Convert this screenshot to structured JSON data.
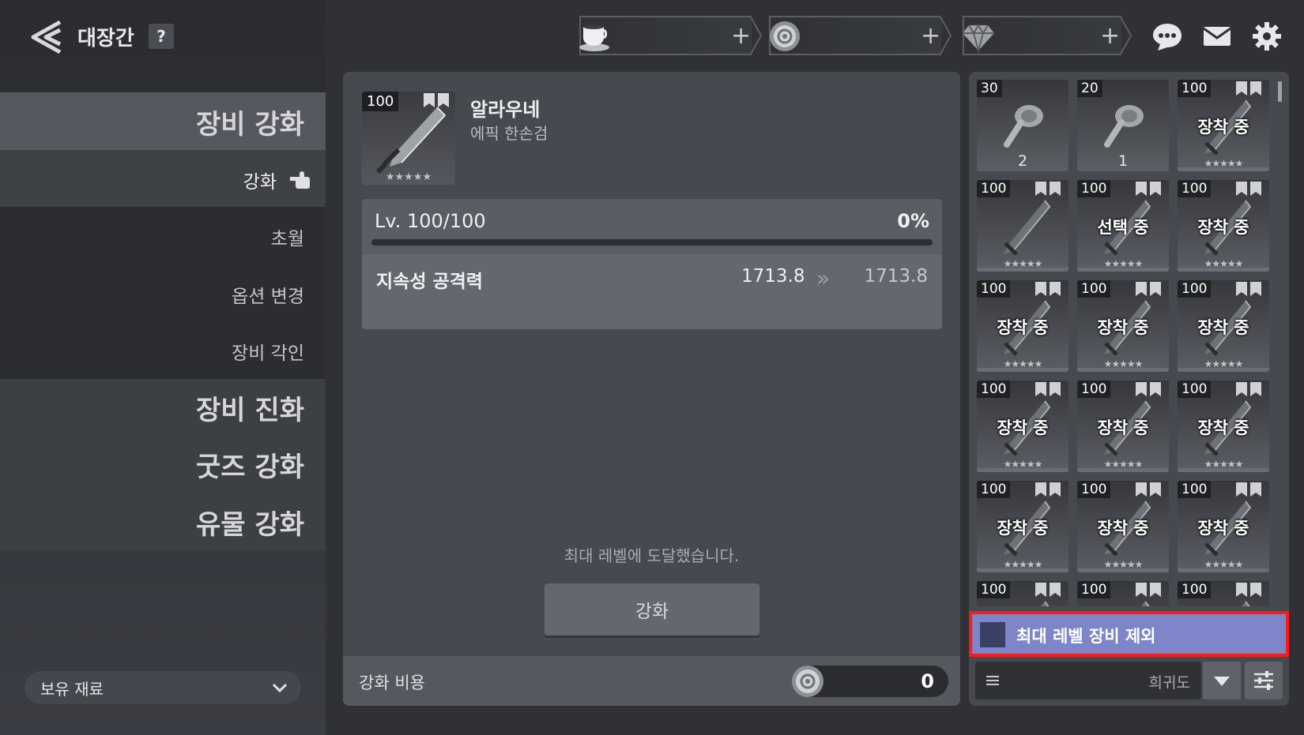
{
  "header": {
    "title": "대장간",
    "help_label": "?"
  },
  "sidebar": {
    "menu": [
      {
        "label": "장비 강화"
      },
      {
        "label": "장비 진화"
      },
      {
        "label": "굿즈 강화"
      },
      {
        "label": "유물 강화"
      }
    ],
    "submenu": [
      {
        "label": "강화"
      },
      {
        "label": "초월"
      },
      {
        "label": "옵션 변경"
      },
      {
        "label": "장비 각인"
      }
    ],
    "resources_label": "보유 재료"
  },
  "currencies": [
    {
      "icon": "teacup-icon",
      "plus": "+"
    },
    {
      "icon": "coin-icon",
      "plus": "+"
    },
    {
      "icon": "diamond-icon",
      "plus": "+"
    }
  ],
  "top_icons": [
    "chat-icon",
    "mail-icon",
    "gear-icon"
  ],
  "item": {
    "level": "100",
    "name": "알라우네",
    "type": "에픽 한손검",
    "lv_text": "Lv. 100/100",
    "progress_pct": "0%",
    "progress": 0,
    "stat_name": "지속성 공격력",
    "stat_current": "1713.8",
    "stat_next": "1713.8",
    "stars": "★★★★★"
  },
  "max_message": "최대 레벨에 도달했습니다.",
  "enhance_button": "강화",
  "cost": {
    "label": "강화 비용",
    "value": "0"
  },
  "inventory": {
    "cells": [
      {
        "lv": "30",
        "badge": "",
        "count": "2",
        "stars": ""
      },
      {
        "lv": "20",
        "badge": "",
        "count": "1",
        "stars": ""
      },
      {
        "lv": "100",
        "badge": "장착 중",
        "count": "",
        "stars": "★★★★★"
      },
      {
        "lv": "100",
        "badge": "",
        "count": "",
        "stars": "★★★★★"
      },
      {
        "lv": "100",
        "badge": "선택 중",
        "count": "",
        "stars": "★★★★★"
      },
      {
        "lv": "100",
        "badge": "장착 중",
        "count": "",
        "stars": "★★★★★"
      },
      {
        "lv": "100",
        "badge": "장착 중",
        "count": "",
        "stars": "★★★★★"
      },
      {
        "lv": "100",
        "badge": "장착 중",
        "count": "",
        "stars": "★★★★★"
      },
      {
        "lv": "100",
        "badge": "장착 중",
        "count": "",
        "stars": "★★★★★"
      },
      {
        "lv": "100",
        "badge": "장착 중",
        "count": "",
        "stars": "★★★★★"
      },
      {
        "lv": "100",
        "badge": "장착 중",
        "count": "",
        "stars": "★★★★★"
      },
      {
        "lv": "100",
        "badge": "장착 중",
        "count": "",
        "stars": "★★★★★"
      },
      {
        "lv": "100",
        "badge": "장착 중",
        "count": "",
        "stars": "★★★★★"
      },
      {
        "lv": "100",
        "badge": "장착 중",
        "count": "",
        "stars": "★★★★★"
      },
      {
        "lv": "100",
        "badge": "장착 중",
        "count": "",
        "stars": "★★★★★"
      },
      {
        "lv": "100",
        "badge": "",
        "count": "",
        "stars": ""
      },
      {
        "lv": "100",
        "badge": "",
        "count": "",
        "stars": ""
      },
      {
        "lv": "100",
        "badge": "",
        "count": "",
        "stars": ""
      }
    ],
    "exclude_max_label": "최대 레벨 장비 제외",
    "sort_label": "희귀도"
  },
  "colors": {
    "accent_purple": "#7e85c8",
    "highlight_red": "#ff1a1a"
  }
}
